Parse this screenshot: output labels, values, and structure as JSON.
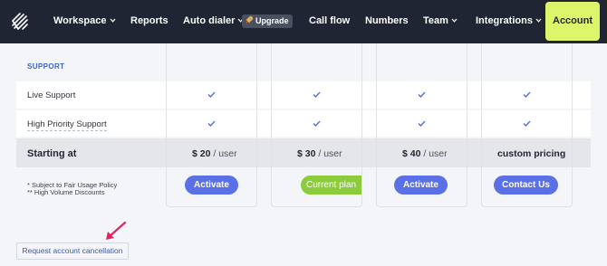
{
  "nav": {
    "logo_icon": "cloudtalk-logo-icon",
    "items": [
      {
        "label": "Workspace",
        "caret": true
      },
      {
        "label": "Reports",
        "caret": false
      },
      {
        "label": "Auto dialer",
        "caret": true
      },
      {
        "label": "Call flow",
        "caret": false
      },
      {
        "label": "Numbers",
        "caret": false
      },
      {
        "label": "Team",
        "caret": true
      },
      {
        "label": "Integrations",
        "caret": true
      }
    ],
    "upgrade_label": "Upgrade",
    "account_label": "Account"
  },
  "plans": {
    "section_label": "SUPPORT",
    "features": [
      {
        "label": "Live Support",
        "checks": [
          true,
          true,
          true,
          true
        ]
      },
      {
        "label": "High Priority Support",
        "checks": [
          true,
          true,
          true,
          true
        ]
      }
    ],
    "starting_label": "Starting at",
    "prices": [
      {
        "amount": "$ 20",
        "unit": "/ user"
      },
      {
        "amount": "$ 30",
        "unit": "/ user"
      },
      {
        "amount": "$ 40",
        "unit": "/ user"
      },
      {
        "amount": "custom pricing",
        "unit": ""
      }
    ],
    "notes": [
      "* Subject to Fair Usage Policy",
      "** High Volume Discounts"
    ],
    "buttons": [
      "Activate",
      "Current plan",
      "Activate",
      "Contact Us"
    ]
  },
  "cancel_link": "Request account cancellation",
  "colors": {
    "nav_bg": "#1f2533",
    "account_bg": "#dcf56a",
    "button_blue": "#5a70e6",
    "button_green": "#8bcb3c",
    "check": "#4a6fd0",
    "arrow": "#e0245e"
  }
}
